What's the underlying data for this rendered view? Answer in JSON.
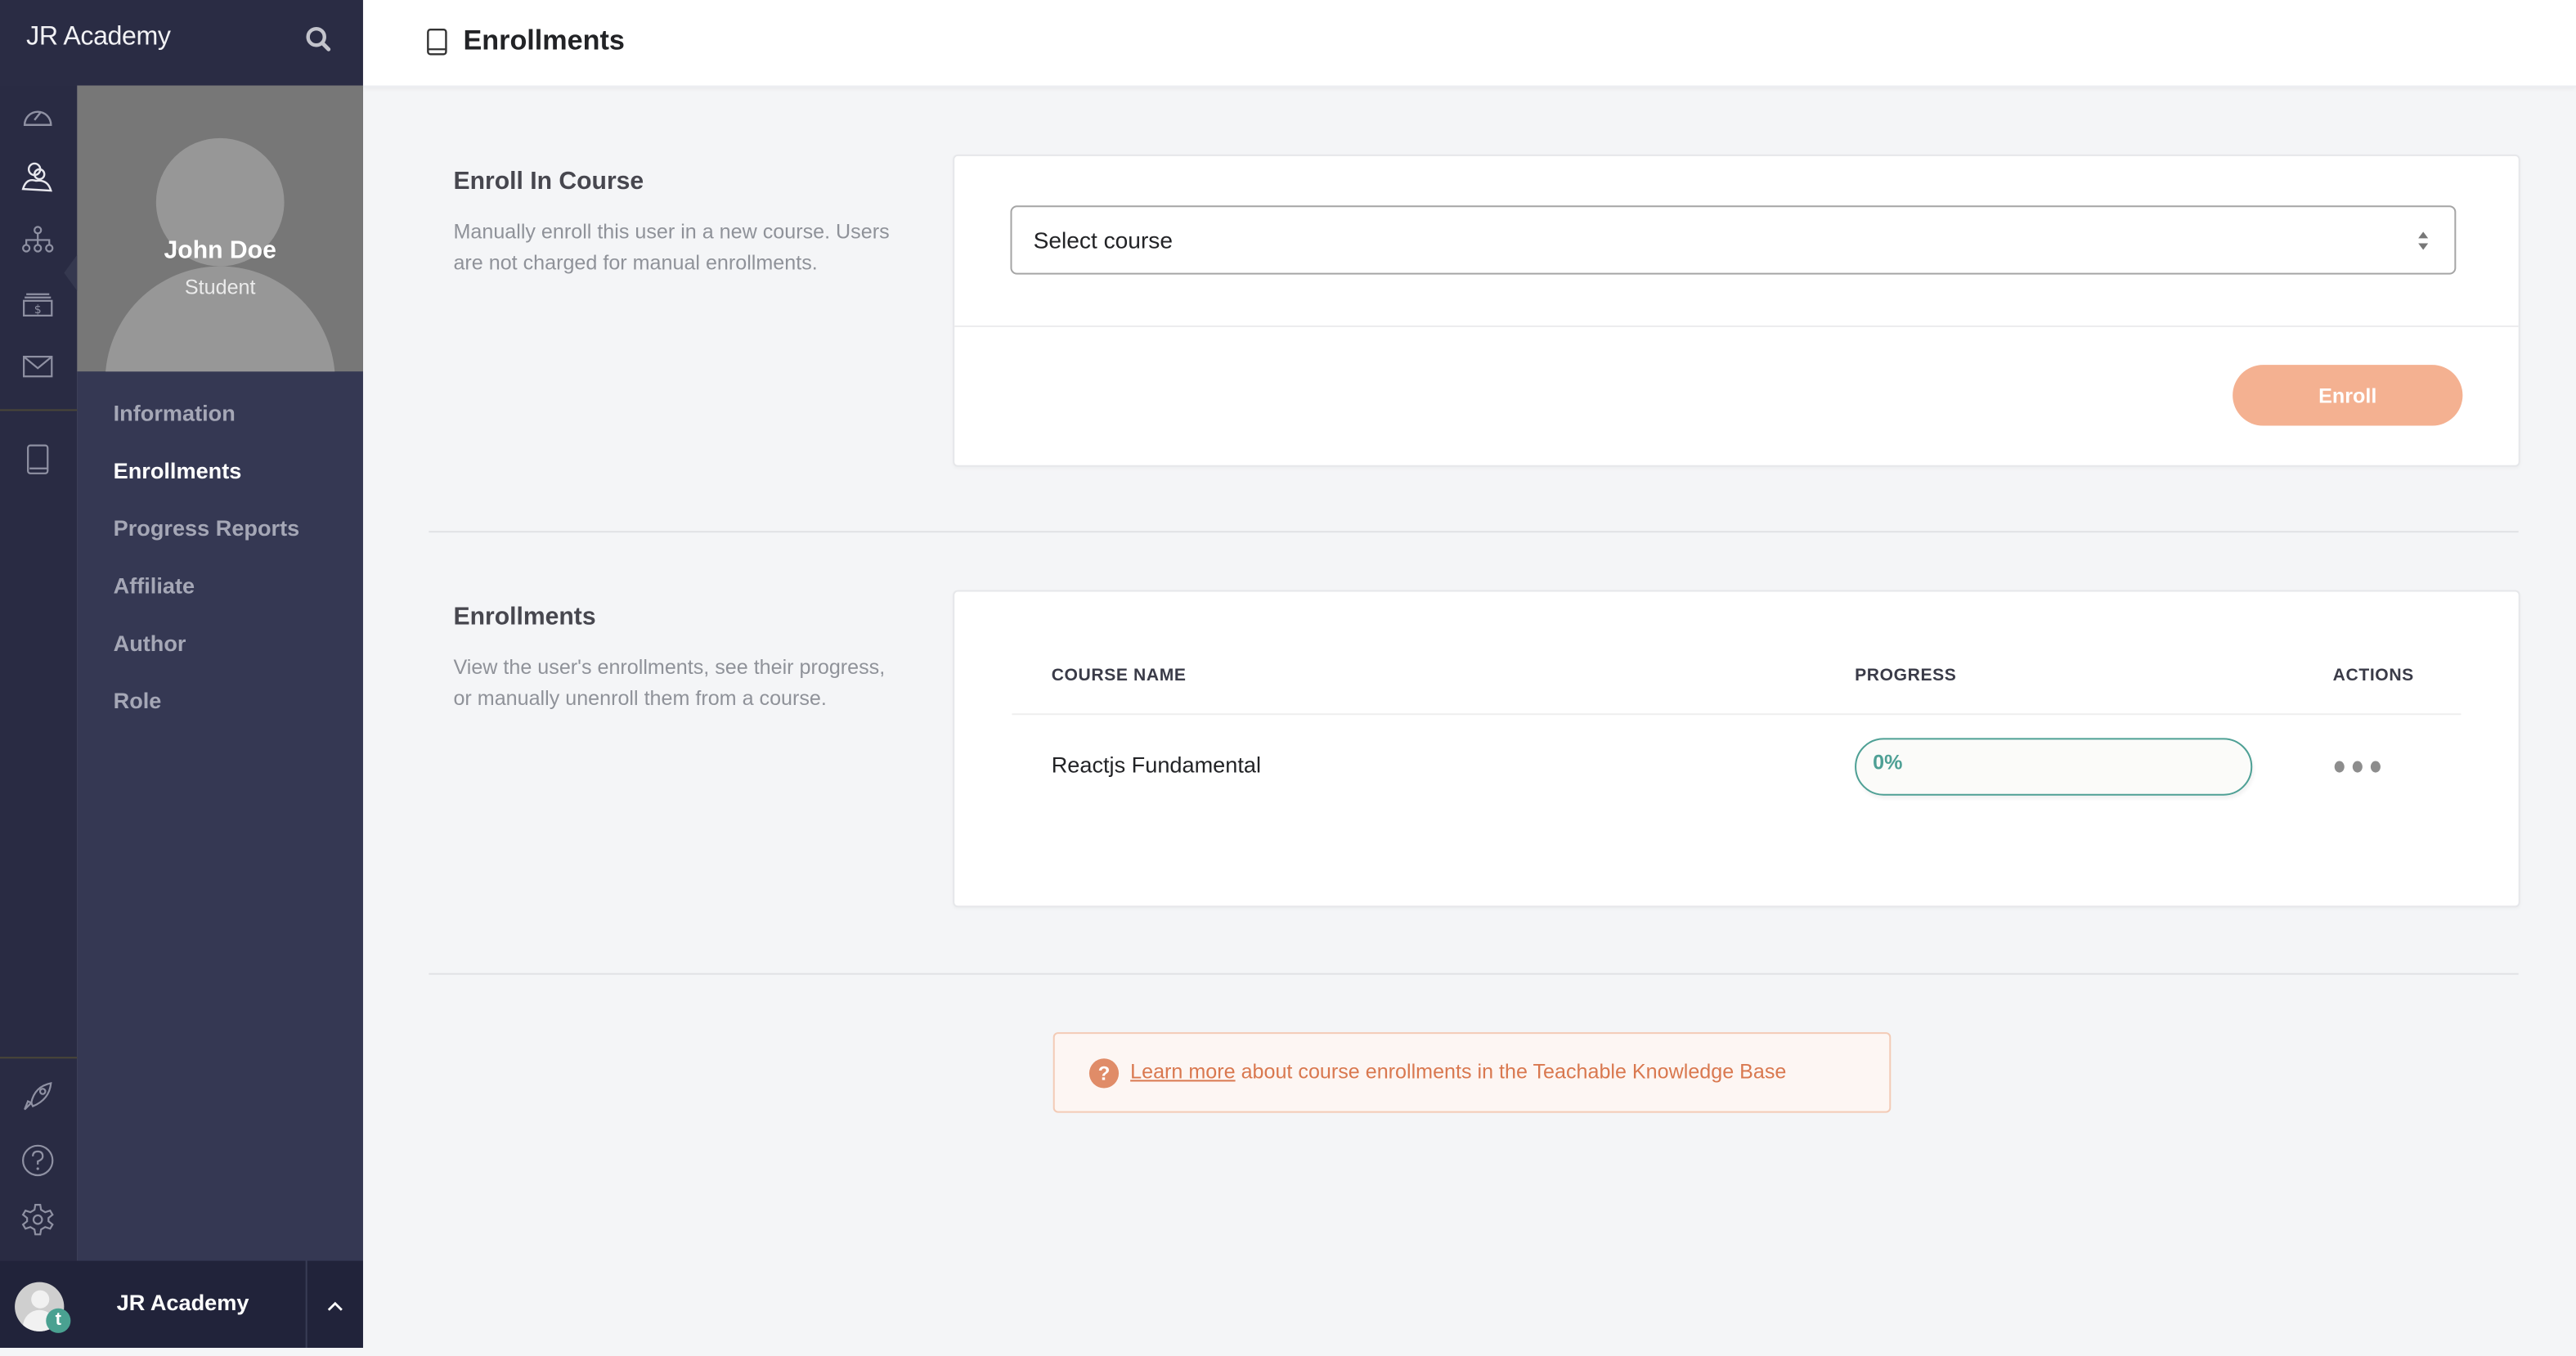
{
  "app": {
    "brand_name": "JR Academy",
    "accent_color": "#f4b191",
    "progress_color": "#4ea095"
  },
  "sidebar": {
    "rail_icons": [
      {
        "name": "dashboard-icon"
      },
      {
        "name": "users-icon",
        "active": true
      },
      {
        "name": "sitemap-icon"
      },
      {
        "name": "sales-icon"
      },
      {
        "name": "mail-icon"
      },
      {
        "name": "book-icon"
      },
      {
        "name": "rocket-icon"
      },
      {
        "name": "help-icon"
      },
      {
        "name": "settings-icon"
      }
    ],
    "profile": {
      "name": "John Doe",
      "role": "Student"
    },
    "menu": [
      {
        "label": "Information",
        "active": false
      },
      {
        "label": "Enrollments",
        "active": true
      },
      {
        "label": "Progress Reports",
        "active": false
      },
      {
        "label": "Affiliate",
        "active": false
      },
      {
        "label": "Author",
        "active": false
      },
      {
        "label": "Role",
        "active": false
      }
    ],
    "footer": {
      "school_name": "JR Academy",
      "badge_letter": "t"
    }
  },
  "header": {
    "title": "Enrollments"
  },
  "enroll_section": {
    "title": "Enroll In Course",
    "description": "Manually enroll this user in a new course. Users are not charged for manual enrollments.",
    "select": {
      "value": "Select course"
    },
    "button_label": "Enroll"
  },
  "enrollments_section": {
    "title": "Enrollments",
    "description": "View the user's enrollments, see their progress, or manually unenroll them from a course.",
    "columns": [
      "COURSE NAME",
      "PROGRESS",
      "ACTIONS"
    ],
    "rows": [
      {
        "course_name": "Reactjs Fundamental",
        "progress_percent": 0,
        "progress_label": "0%"
      }
    ]
  },
  "knowledge_base_note": {
    "link_text": "Learn more",
    "text": " about course enrollments in the Teachable Knowledge Base"
  }
}
